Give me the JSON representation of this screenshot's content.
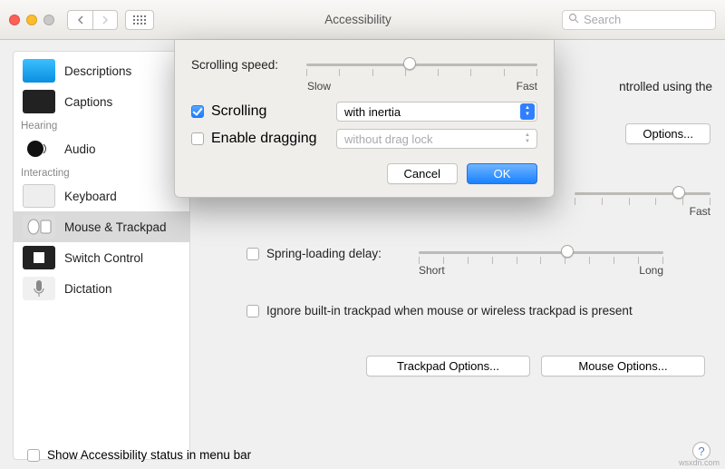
{
  "title": "Accessibility",
  "search_placeholder": "Search",
  "sidebar": {
    "items": [
      {
        "label": "Descriptions"
      },
      {
        "label": "Captions"
      }
    ],
    "hearing_label": "Hearing",
    "audio_label": "Audio",
    "interacting_label": "Interacting",
    "keyboard_label": "Keyboard",
    "mouse_label": "Mouse & Trackpad",
    "switch_label": "Switch Control",
    "dictation_label": "Dictation"
  },
  "main": {
    "truncated_text": "ntrolled using the",
    "options_btn": "Options...",
    "fast_label": "Fast",
    "spring_label": "Spring-loading delay:",
    "short_label": "Short",
    "long_label": "Long",
    "ignore_label": "Ignore built-in trackpad when mouse or wireless trackpad is present",
    "trackpad_btn": "Trackpad Options...",
    "mouse_btn": "Mouse Options..."
  },
  "footer": {
    "status_label": "Show Accessibility status in menu bar"
  },
  "sheet": {
    "speed_label": "Scrolling speed:",
    "slow": "Slow",
    "fast": "Fast",
    "scrolling_label": "Scrolling",
    "scrolling_value": "with inertia",
    "dragging_label": "Enable dragging",
    "dragging_value": "without drag lock",
    "cancel": "Cancel",
    "ok": "OK"
  },
  "watermark": "wsxdn.com"
}
